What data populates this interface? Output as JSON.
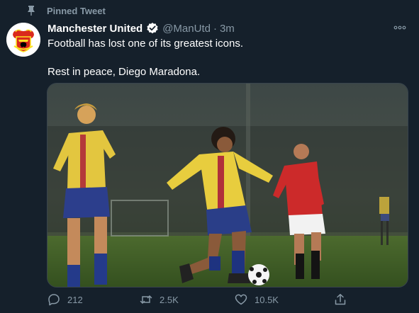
{
  "pinned_label": "Pinned Tweet",
  "author": {
    "name": "Manchester United",
    "handle": "@ManUtd",
    "separator": "·",
    "time": "3m",
    "verified": true,
    "avatar_icon": "manchester-united-crest-icon"
  },
  "tweet": {
    "line1": "Football has lost one of its greatest icons.",
    "line2": "Rest in peace, Diego Maradona."
  },
  "actions": {
    "replies": "212",
    "retweets": "2.5K",
    "likes": "10.5K"
  },
  "icons": {
    "pin": "pin-icon",
    "verified": "verified-badge-icon",
    "more": "more-options-icon",
    "reply": "reply-icon",
    "retweet": "retweet-icon",
    "like": "heart-icon",
    "share": "share-icon"
  },
  "colors": {
    "background": "#15202b",
    "secondary_text": "#8899a6",
    "brand_red": "#da291c",
    "crest_yellow": "#fbe122"
  }
}
